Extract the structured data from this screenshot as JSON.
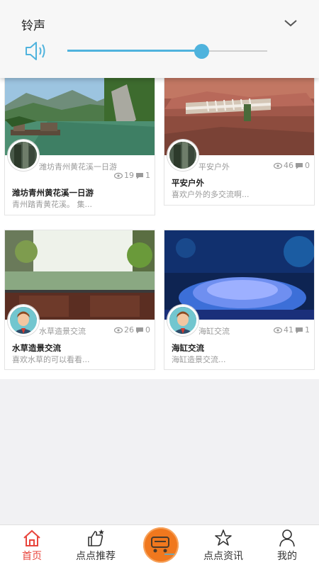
{
  "ringtone": {
    "title": "铃声",
    "volume_percent": 67
  },
  "cards": [
    {
      "user": "潍坊青州黄花溪一日游",
      "views": "19",
      "comments": "1",
      "title": "潍坊青州黄花溪一日游",
      "desc": "青州踏青黄花溪。 集..."
    },
    {
      "user": "平安户外",
      "views": "46",
      "comments": "0",
      "title": "平安户外",
      "desc": "喜欢户外的多交流啊..."
    },
    {
      "user": "水草造景交流",
      "views": "26",
      "comments": "0",
      "title": "水草造景交流",
      "desc": "喜欢水草的可以看看..."
    },
    {
      "user": "海缸交流",
      "views": "41",
      "comments": "1",
      "title": "海缸交流",
      "desc": "海缸造景交流..."
    }
  ],
  "nav": {
    "home": "首页",
    "recommend": "点点推荐",
    "news": "点点资讯",
    "mine": "我的"
  },
  "colors": {
    "accent": "#e8453c",
    "slider": "#4fb3dd",
    "center_button": "#f0781e"
  }
}
